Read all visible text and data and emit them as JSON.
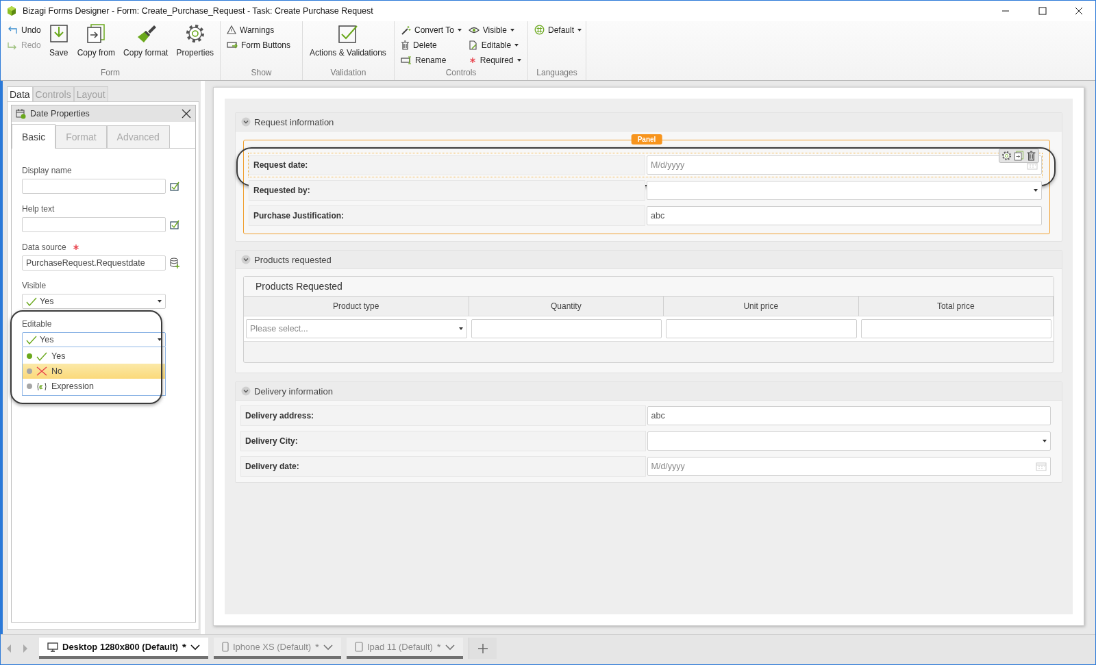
{
  "window": {
    "title": "Bizagi Forms Designer  - Form: Create_Purchase_Request - Task:  Create Purchase Request"
  },
  "ribbon": {
    "groups": [
      {
        "label": "Form",
        "items": [
          {
            "kind": "small",
            "label": "Undo",
            "disabled": false,
            "dropdown": false
          },
          {
            "kind": "small",
            "label": "Redo",
            "disabled": true,
            "dropdown": false
          },
          {
            "kind": "large",
            "label": "Save",
            "disabled": false,
            "dropdown": false
          },
          {
            "kind": "large",
            "label": "Copy from",
            "disabled": false,
            "dropdown": false
          },
          {
            "kind": "large",
            "label": "Copy format",
            "disabled": false,
            "dropdown": false
          },
          {
            "kind": "large",
            "label": "Properties",
            "disabled": false,
            "dropdown": false
          }
        ]
      },
      {
        "label": "Show",
        "items": [
          {
            "kind": "small",
            "label": "Warnings",
            "disabled": false,
            "dropdown": false
          },
          {
            "kind": "small",
            "label": "Form Buttons",
            "disabled": false,
            "dropdown": false
          }
        ]
      },
      {
        "label": "Validation",
        "items": [
          {
            "kind": "large",
            "label": "Actions & Validations",
            "disabled": false,
            "dropdown": false
          }
        ]
      },
      {
        "label": "Controls",
        "items": [
          {
            "kind": "small",
            "label": "Convert To",
            "disabled": false,
            "dropdown": true
          },
          {
            "kind": "small",
            "label": "Delete",
            "disabled": false,
            "dropdown": false
          },
          {
            "kind": "small",
            "label": "Rename",
            "disabled": false,
            "dropdown": false
          },
          {
            "kind": "small",
            "label": "Visible",
            "disabled": false,
            "dropdown": true
          },
          {
            "kind": "small",
            "label": "Editable",
            "disabled": false,
            "dropdown": true
          },
          {
            "kind": "small",
            "label": "Required",
            "disabled": false,
            "dropdown": true
          }
        ]
      },
      {
        "label": "Languages",
        "items": [
          {
            "kind": "small",
            "label": "Default",
            "disabled": false,
            "dropdown": true
          }
        ]
      }
    ]
  },
  "left_tabs": [
    {
      "label": "Data",
      "selected": true
    },
    {
      "label": "Controls",
      "selected": false
    },
    {
      "label": "Layout",
      "selected": false
    }
  ],
  "properties": {
    "title": "Date Properties",
    "tabs": [
      {
        "label": "Basic",
        "selected": true
      },
      {
        "label": "Format",
        "selected": false
      },
      {
        "label": "Advanced",
        "selected": false
      }
    ],
    "fields": [
      {
        "kind": "text",
        "label": "Display name",
        "required": false
      },
      {
        "kind": "text",
        "label": "Help text",
        "required": false
      },
      {
        "kind": "source",
        "label": "Data source",
        "required": true,
        "value": "PurchaseRequest.Requestdate"
      },
      {
        "kind": "select",
        "label": "Visible",
        "required": false,
        "value": "Yes",
        "expanded": false,
        "annotated": false
      },
      {
        "kind": "select",
        "label": "Editable",
        "required": false,
        "value": "Yes",
        "expanded": true,
        "annotated": true,
        "options": [
          {
            "kind": "check",
            "label": "Yes",
            "selected": true,
            "highlighted": false
          },
          {
            "kind": "cross",
            "label": "No",
            "selected": false,
            "highlighted": true
          },
          {
            "kind": "expression",
            "label": "Expression",
            "selected": false,
            "highlighted": false
          }
        ]
      }
    ]
  },
  "form": {
    "sections": [
      {
        "kind": "panel",
        "title": "Request information",
        "panel_label": "Panel",
        "rows": [
          {
            "kind": "date",
            "label": "Request date:",
            "placeholder": "M/d/yyyy",
            "selected": true,
            "annotated": true
          },
          {
            "kind": "combo",
            "label": "Requested by:",
            "selected": false,
            "annotated": false
          },
          {
            "kind": "text",
            "label": "Purchase Justification:",
            "value": "abc",
            "selected": false,
            "annotated": false
          }
        ]
      },
      {
        "kind": "grid",
        "title": "Products requested",
        "grid_title": "Products Requested",
        "columns": [
          "Product type",
          "Quantity",
          "Unit price",
          "Total price"
        ],
        "cells": [
          {
            "kind": "combo",
            "placeholder": "Please select..."
          },
          {
            "kind": "text"
          },
          {
            "kind": "text"
          },
          {
            "kind": "text"
          }
        ]
      },
      {
        "kind": "rows",
        "title": "Delivery information",
        "rows": [
          {
            "kind": "text",
            "label": "Delivery address:",
            "value": "abc",
            "selected": false,
            "annotated": false
          },
          {
            "kind": "combo",
            "label": "Delivery City:",
            "selected": false,
            "annotated": false
          },
          {
            "kind": "date",
            "label": "Delivery date:",
            "placeholder": "M/d/yyyy",
            "selected": false,
            "annotated": false
          }
        ]
      }
    ]
  },
  "devices": [
    {
      "kind": "desktop",
      "label": "Desktop 1280x800 (Default)",
      "marker": "*",
      "selected": true
    },
    {
      "kind": "phone",
      "label": "Iphone XS (Default)",
      "marker": "*",
      "selected": false
    },
    {
      "kind": "tablet",
      "label": "Ipad 11 (Default)",
      "marker": "*",
      "selected": false
    }
  ]
}
